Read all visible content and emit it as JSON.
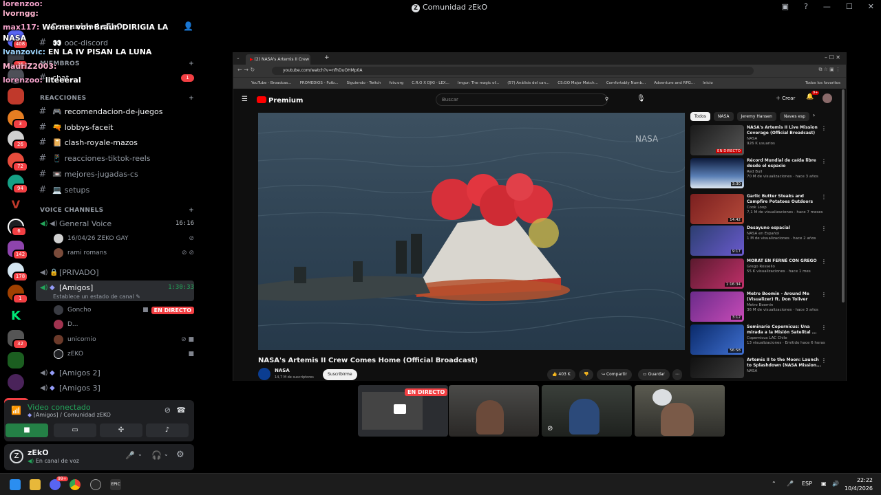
{
  "window": {
    "title": "Comunidad zEkO"
  },
  "chat_overlay": [
    {
      "user": "lorenzoo:",
      "text": ""
    },
    {
      "user": "lvorngg:",
      "text": ""
    },
    {
      "user": "max117:",
      "text": "Werner von Braun DIRIGIA LA"
    },
    {
      "user": "",
      "text": "NASA"
    },
    {
      "user": "lvanzovic:",
      "text": "EN LA IV PISAN LA LUNA"
    },
    {
      "user": "MauriZ2003:",
      "text": ""
    },
    {
      "user": "lorenzoo:",
      "text": "liteeeral"
    }
  ],
  "sidebar": {
    "header": "Comunidad zEkO",
    "channels": [
      {
        "name": "ooc-discord",
        "emoji": "👀"
      },
      {
        "name": "chat",
        "emoji": ""
      },
      {
        "name": "recomendacion-de-juegos",
        "emoji": "🎮"
      },
      {
        "name": "lobbys-faceit",
        "emoji": "🔫"
      },
      {
        "name": "clash-royale-mazos",
        "emoji": "📔"
      },
      {
        "name": "reacciones-tiktok-reels",
        "emoji": "📱"
      },
      {
        "name": "mejores-jugadas-cs",
        "emoji": "📼"
      },
      {
        "name": "setups",
        "emoji": "💻"
      }
    ],
    "categories": {
      "miembros": "MIEMBROS",
      "reacciones": "REACCIONES",
      "voice": "VOICE CHANNELS"
    },
    "mention_badge": "1",
    "voice": {
      "general": {
        "name": "General Voice",
        "time": "16:16"
      },
      "general_members": [
        "16/04/26 ZEKO GAY",
        "rami romans"
      ],
      "privado": "[PRIVADO]",
      "amigos": {
        "name": "[Amigos]",
        "time": "1:30:33",
        "status": "Establece un estado de canal"
      },
      "amigos_members": [
        {
          "name": "Goncho",
          "live": "EN DIRECTO"
        },
        {
          "name": "D...",
          "live": ""
        },
        {
          "name": "unicornio",
          "live": ""
        },
        {
          "name": "zEKO",
          "live": ""
        }
      ],
      "amigos2": "[Amigos 2]",
      "amigos3": "[Amigos 3]"
    }
  },
  "rail_badges": [
    "408",
    "26",
    "3",
    "26",
    "72",
    "94",
    "6",
    "142",
    "178",
    "1",
    "32"
  ],
  "rail_new": "NUEVO",
  "voice_panel": {
    "status": "Video conectado",
    "sub": "[Amigos] / Comunidad zEKO"
  },
  "user_panel": {
    "name": "zEkO",
    "status": "En canal de voz"
  },
  "browser": {
    "tab_title": "(2) NASA's Artemis II Crew",
    "url": "youtube.com/watch?v=nfhDuOHMp0A",
    "bookmarks": [
      "YouTube - Broadcas...",
      "PROMEDIOS - Futb...",
      "Siguiendo - Twitch",
      "fctv.org",
      "C.R.O X DJKI - LEX...",
      "Imgur: The magic of...",
      "(57) Análisis del can...",
      "CS:GO Major Match...",
      "Comfortably Numb...",
      "Adventure and RPG...",
      "Inicio",
      "Todos los favoritos"
    ]
  },
  "youtube": {
    "logo": "Premium",
    "search_placeholder": "Buscar",
    "create": "Crear",
    "notif_count": "9+",
    "video_title": "NASA's Artemis II Crew Comes Home (Official Broadcast)",
    "channel": "NASA",
    "subscribers": "14,7 M de suscriptores",
    "subscribe": "Suscribirme",
    "likes": "403 K",
    "share": "Compartir",
    "save": "Guardar",
    "watermark": "NASA",
    "chips": [
      "Todos",
      "NASA",
      "Jeremy Hansen",
      "Naves esp"
    ],
    "recommendations": [
      {
        "title": "NASA's Artemis II Live Mission Coverage (Official Broadcast)",
        "channel": "NASA",
        "meta": "926 K usuarios",
        "dur": "EN DIRECTO"
      },
      {
        "title": "Récord Mundial de caída libre desde el espacio",
        "channel": "Red Bull",
        "meta": "70 M de visualizaciones · hace 3 años",
        "dur": "3:30"
      },
      {
        "title": "Garlic Butter Steaks and Campfire Potatoes Outdoors",
        "channel": "Cook Loop",
        "meta": "7,1 M de visualizaciones · hace 7 meses",
        "dur": "14:42"
      },
      {
        "title": "Desayuno espacial",
        "channel": "NASA en Español",
        "meta": "1 M de visualizaciones · hace 2 años",
        "dur": "9:17"
      },
      {
        "title": "MORAT EN FERNÉ CON GREGO",
        "channel": "Grego Rossello",
        "meta": "55 K visualizaciones · hace 1 mes",
        "dur": "1:16:34"
      },
      {
        "title": "Metro Boomin - Around Me (Visualizer) ft. Don Toliver",
        "channel": "Metro Boomin",
        "meta": "36 M de visualizaciones · hace 3 años",
        "dur": "3:12"
      },
      {
        "title": "Seminario Copernicus: Una mirada a la Misión Satelital ...",
        "channel": "Copernicus LAC Chile",
        "meta": "13 visualizaciones · Emitido hace 6 horas",
        "dur": "56:58"
      },
      {
        "title": "Artemis II to the Moon: Launch to Splashdown (NASA Mission...",
        "channel": "NASA",
        "meta": "",
        "dur": ""
      }
    ]
  },
  "stream_tiles": {
    "live_label": "EN DIRECTO"
  },
  "taskbar": {
    "lang": "ESP",
    "time": "22:22",
    "date": "10/4/2026",
    "discord_badge": "99+"
  }
}
